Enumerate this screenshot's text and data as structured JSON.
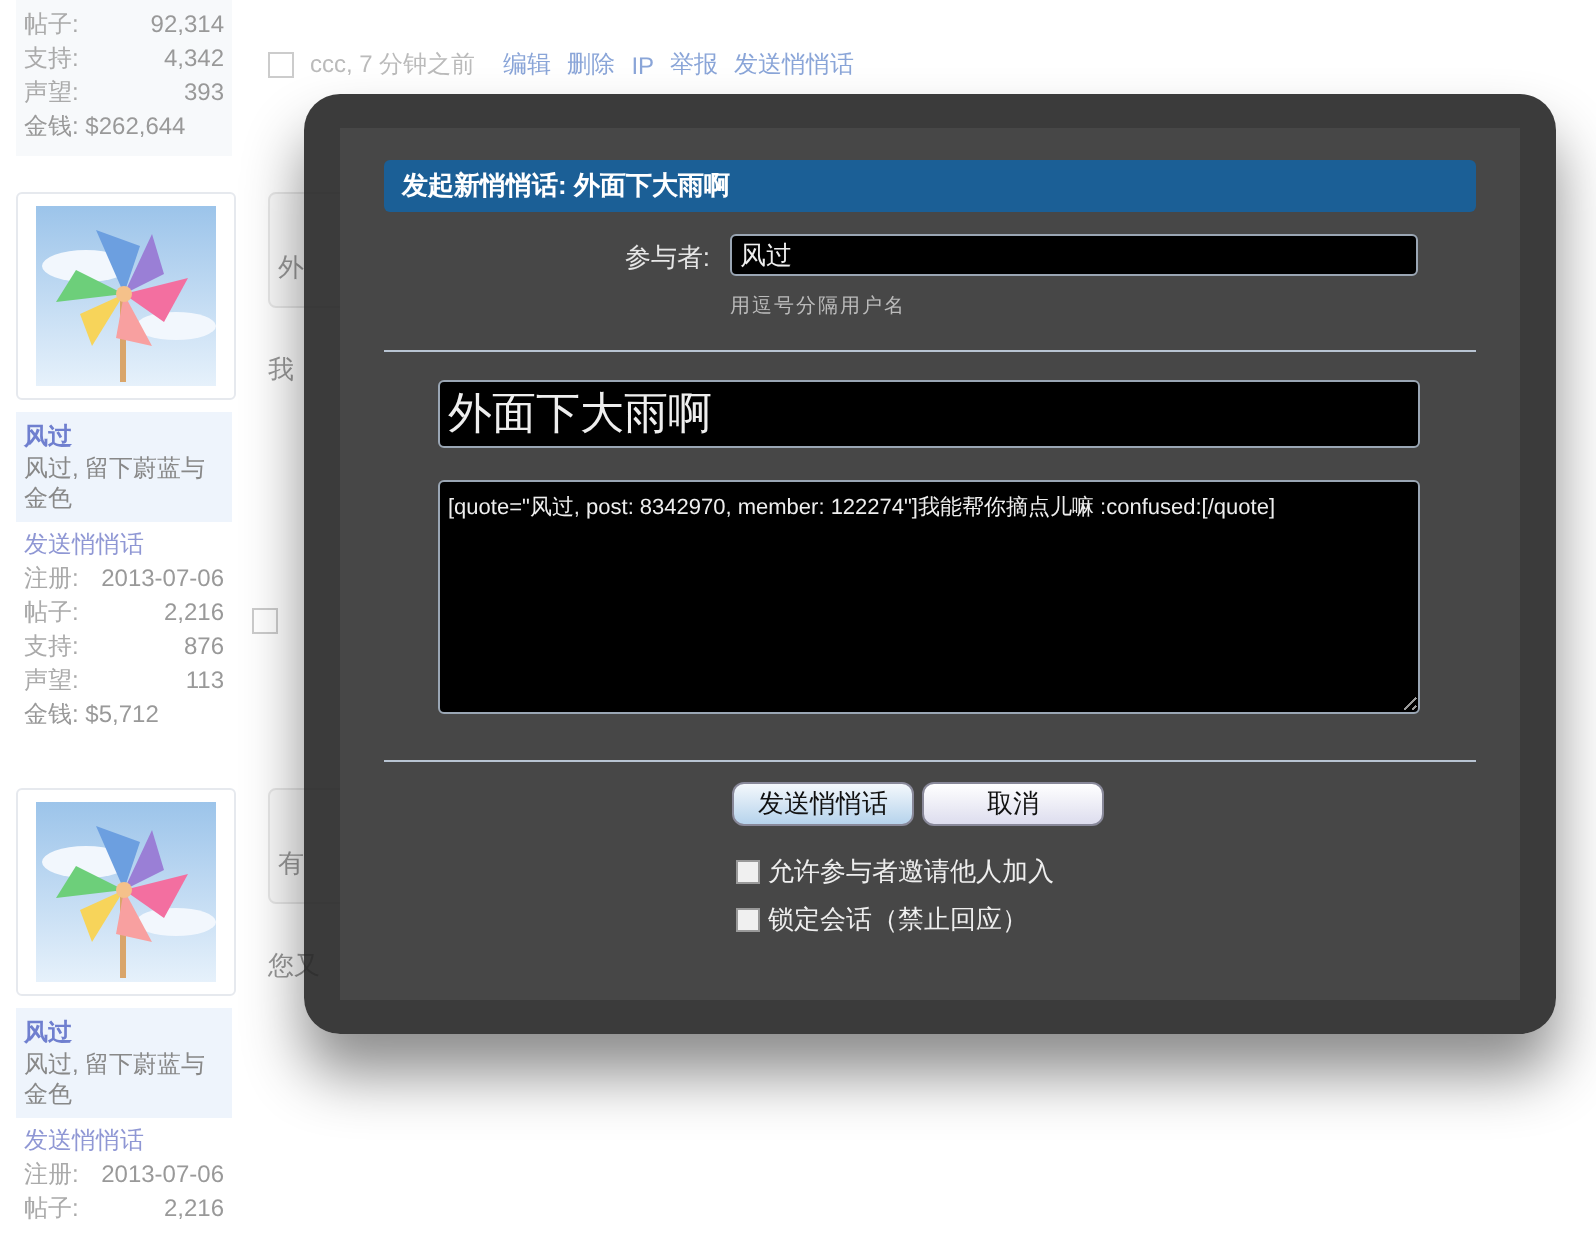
{
  "top_user": {
    "stats": [
      {
        "label": "帖子:",
        "value": "92,314"
      },
      {
        "label": "支持:",
        "value": "4,342"
      },
      {
        "label": "声望:",
        "value": "393"
      }
    ],
    "money": "金钱: $262,644"
  },
  "top_footer": {
    "checked": false,
    "meta": "ccc, 7 分钟之前",
    "links": [
      "编辑",
      "删除",
      "IP",
      "举报",
      "发送悄悄话"
    ]
  },
  "posts": [
    {
      "user": {
        "name": "风过",
        "title": "风过, 留下蔚蓝与金色",
        "pm_link": "发送悄悄话",
        "stats": [
          {
            "label": "注册:",
            "value": "2013-07-06"
          },
          {
            "label": "帖子:",
            "value": "2,216"
          },
          {
            "label": "支持:",
            "value": "876"
          },
          {
            "label": "声望:",
            "value": "113"
          }
        ],
        "money": "金钱: $5,712"
      },
      "quote": {
        "text": "外"
      },
      "message": "我",
      "footer": {
        "checked": false
      }
    },
    {
      "user": {
        "name": "风过",
        "title": "风过, 留下蔚蓝与金色",
        "pm_link": "发送悄悄话",
        "stats": [
          {
            "label": "注册:",
            "value": "2013-07-06"
          },
          {
            "label": "帖子:",
            "value": "2,216"
          }
        ]
      },
      "quote": {
        "text": "有"
      },
      "message": "您又"
    }
  ],
  "dialog": {
    "title": "发起新悄悄话: 外面下大雨啊",
    "participants_label": "参与者:",
    "participants": "风过",
    "participants_hint": "用逗号分隔用户名",
    "subject": "外面下大雨啊",
    "message": "[quote=\"风过, post: 8342970, member: 122274\"]我能帮你摘点儿嘛 :confused:[/quote]",
    "buttons": [
      {
        "label": "发送悄悄话",
        "kind": "primary"
      },
      {
        "label": "取消",
        "kind": "secondary"
      }
    ],
    "options": [
      {
        "label": "允许参与者邀请他人加入",
        "checked": false
      },
      {
        "label": "锁定会话（禁止回应）",
        "checked": false
      }
    ]
  }
}
